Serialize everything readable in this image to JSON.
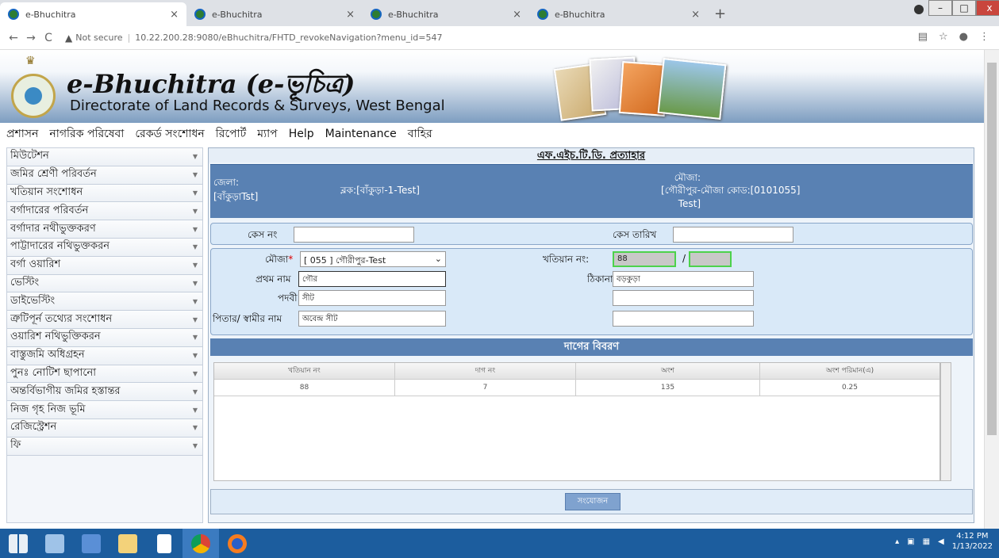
{
  "browser": {
    "tabs": [
      {
        "title": "e-Bhuchitra",
        "active": true
      },
      {
        "title": "e-Bhuchitra",
        "active": false
      },
      {
        "title": "e-Bhuchitra",
        "active": false
      },
      {
        "title": "e-Bhuchitra",
        "active": false
      }
    ],
    "new_tab": "+",
    "back": "←",
    "forward": "→",
    "reload": "C",
    "security": "Not secure",
    "url": "10.22.200.28:9080/eBhuchitra/FHTD_revokeNavigation?menu_id=547"
  },
  "header": {
    "title": "e-Bhuchitra (e-ভূচিত্র)",
    "subtitle": "Directorate of Land Records & Surveys, West Bengal"
  },
  "menu": [
    "প্রশাসন",
    "নাগরিক পরিষেবা",
    "রেকর্ড সংশোধন",
    "রিপোর্ট",
    "ম্যাপ",
    "Help",
    "Maintenance",
    "বাহির"
  ],
  "sidebar": [
    "মিউটেশন",
    "জমির শ্রেণী পরিবর্তন",
    "খতিয়ান সংশোধন",
    "বর্গাদারের পরিবর্তন",
    "বর্গাদার নথীভুক্তকরণ",
    "পাট্টাদারের নথিভুক্তকরন",
    "বর্গা ওয়ারিশ",
    "ভেস্টিং",
    "ডাইভেস্টিং",
    "ত্রুটিপূর্ন তথ্যের সংশোধন",
    "ওয়ারিশ নথিভুক্তিকরন",
    "বাস্তুজমি অধিগ্রহন",
    "পুনঃ নোটিশ ছাপানো",
    "অন্তর্বিভাগীয় জমির হস্তান্তর",
    "নিজ গৃহ নিজ ভূমি",
    "রেজিস্ট্রেশন",
    "ফি"
  ],
  "page": {
    "title": "এফ.এইচ.টি.ডি. প্রত্যাহার",
    "info": {
      "district_label": "জেলা:",
      "district_value": "[বাঁকুড়াTst]",
      "block": "ব্লক:[বাঁকুড়া-1-Test]",
      "mouza_label": "মৌজা:",
      "mouza_value1": "[গৌরীপুর-",
      "mouza_value2": "Test]",
      "mouza_code": "মৌজা কোড:[0101055]"
    },
    "case_no_label": "কেস নং",
    "case_no_value": "",
    "case_date_label": "কেস তারিখ",
    "case_date_value": "",
    "mouza_field_label": "মৌজা",
    "required": "*",
    "mouza_select": "[ 055 ] গৌরীপুর-Test",
    "khatian_label": "খতিয়ান নং:",
    "khatian_value": "88",
    "khatian_sep": "/",
    "khatian_value2": "",
    "first_name_label": "প্রথম নাম",
    "first_name_value": "গৌর",
    "address_label": "ঠিকানা",
    "address_value": "বড়কুড়া",
    "title_label": "পদবী",
    "title_value": "সীট",
    "father_label": "পিতার/ স্বামীর নাম",
    "father_value": "অবেন্দ্র সীট",
    "section_title": "দাগের বিবরণ",
    "grid": {
      "headers": [
        "খতিয়ান নং",
        "দাগ নং",
        "অংশ",
        "অংশ পরিমান(এ)"
      ],
      "rows": [
        [
          "88",
          "7",
          "135",
          "0.25"
        ]
      ]
    },
    "submit": "সংযোজন"
  },
  "taskbar": {
    "time": "4:12 PM",
    "date": "1/13/2022"
  },
  "colors": {
    "accent": "#5981b3",
    "sidebar_bg": "#f3f6fa",
    "taskbar": "#1c5d9e"
  }
}
